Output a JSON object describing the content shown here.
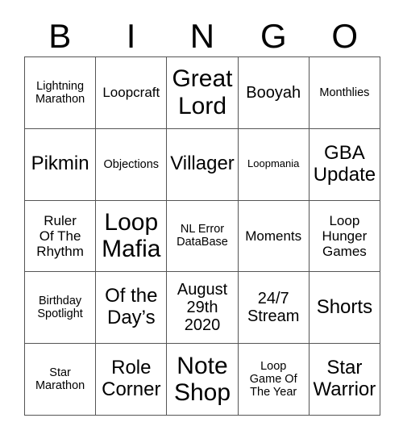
{
  "card": {
    "header_letters": [
      "B",
      "I",
      "N",
      "G",
      "O"
    ],
    "columns": [
      {
        "letter": "B",
        "cells": [
          {
            "text": "Lightning\nMarathon",
            "size": "sm"
          },
          {
            "text": "Pikmin",
            "size": "xl"
          },
          {
            "text": "Ruler\nOf The\nRhythm",
            "size": "md"
          },
          {
            "text": "Birthday\nSpotlight",
            "size": "sm"
          },
          {
            "text": "Star\nMarathon",
            "size": "sm"
          }
        ]
      },
      {
        "letter": "I",
        "cells": [
          {
            "text": "Loopcraft",
            "size": "md"
          },
          {
            "text": "Objections",
            "size": "sm"
          },
          {
            "text": "Loop\nMafia",
            "size": "xxl"
          },
          {
            "text": "Of the\nDay’s",
            "size": "xl"
          },
          {
            "text": "Role\nCorner",
            "size": "xl"
          }
        ]
      },
      {
        "letter": "N",
        "cells": [
          {
            "text": "Great\nLord",
            "size": "xxl"
          },
          {
            "text": "Villager",
            "size": "xl"
          },
          {
            "text": "NL Error\nDataBase",
            "size": "sm"
          },
          {
            "text": "August\n29th\n2020",
            "size": "lg"
          },
          {
            "text": "Note\nShop",
            "size": "xxl"
          }
        ]
      },
      {
        "letter": "G",
        "cells": [
          {
            "text": "Booyah",
            "size": "lg"
          },
          {
            "text": "Loopmania",
            "size": "xs"
          },
          {
            "text": "Moments",
            "size": "md"
          },
          {
            "text": "24/7\nStream",
            "size": "lg"
          },
          {
            "text": "Loop\nGame Of\nThe Year",
            "size": "sm"
          }
        ]
      },
      {
        "letter": "O",
        "cells": [
          {
            "text": "Monthlies",
            "size": "sm"
          },
          {
            "text": "GBA\nUpdate",
            "size": "xl"
          },
          {
            "text": "Loop\nHunger\nGames",
            "size": "md"
          },
          {
            "text": "Shorts",
            "size": "xl"
          },
          {
            "text": "Star\nWarrior",
            "size": "xl"
          }
        ]
      }
    ],
    "colors": {
      "background": "#ffffff",
      "text": "#000000",
      "border": "#555555"
    }
  }
}
